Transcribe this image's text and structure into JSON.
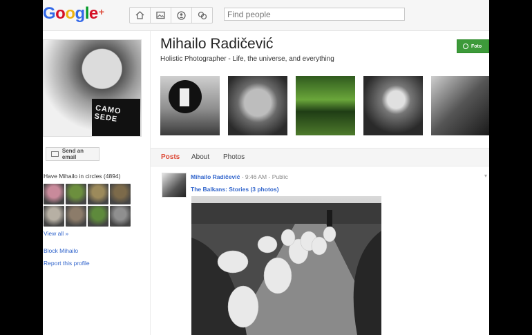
{
  "topbar": {
    "logo": {
      "letters": [
        "G",
        "o",
        "o",
        "g",
        "l",
        "e"
      ],
      "colors": [
        "#3369e8",
        "#d50f25",
        "#eeb211",
        "#3369e8",
        "#009925",
        "#d50f25"
      ],
      "plus": "+"
    },
    "nav_icons": [
      "home-icon",
      "photos-icon",
      "profile-icon",
      "circles-icon"
    ],
    "search": {
      "placeholder": "Find people"
    }
  },
  "profile": {
    "name": "Mihailo Radičević",
    "tagline": "Holistic Photographer - Life, the universe, and everything",
    "shirt_text": "CAMO SEDE",
    "action_button": "Foto",
    "send_email": "Send an email",
    "circles_title": "Have Mihailo in circles (4894)",
    "circle_faces": [
      "#c98a9b",
      "#6c8f3e",
      "#9c8a5b",
      "#7c6a4a",
      "#b7b0a4",
      "#8c7c6a",
      "#5e8a3c",
      "#8f8f8f"
    ],
    "view_all": "View all »",
    "block": "Block Mihailo",
    "report": "Report this profile"
  },
  "tabs": [
    {
      "label": "Posts",
      "active": true
    },
    {
      "label": "About",
      "active": false
    },
    {
      "label": "Photos",
      "active": false
    }
  ],
  "post": {
    "author": "Mihailo Radičević",
    "time": "9:46 AM",
    "visibility": "Public",
    "title": "The Balkans: Stories (3 photos)"
  }
}
